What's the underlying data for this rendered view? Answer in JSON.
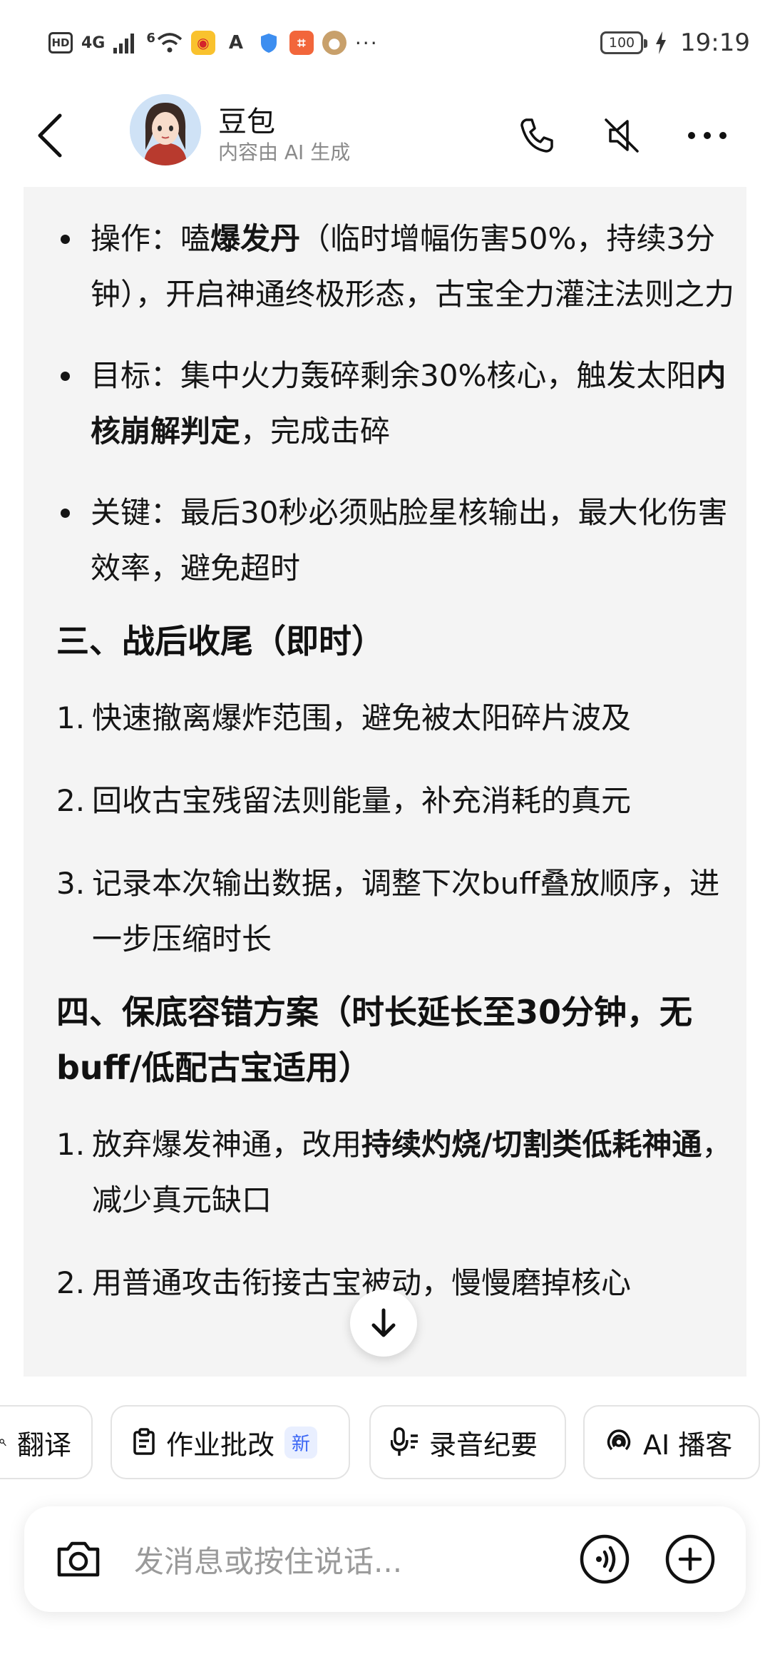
{
  "status_bar": {
    "hd": "HD",
    "network": "4G",
    "wifi_tag": "6",
    "dots": "···",
    "battery": "100",
    "time": "19:19"
  },
  "header": {
    "title": "豆包",
    "subtitle": "内容由 AI 生成"
  },
  "content": {
    "bullets_top": [
      {
        "pre": "操作：嗑",
        "bold": "爆发丹",
        "post": "（临时增幅伤害50%，持续3分钟），开启神通终极形态，古宝全力灌注法则之力"
      },
      {
        "pre": "目标：集中火力轰碎剩余30%核心，触发太阳",
        "bold": "内核崩解判定",
        "post": "，完成击碎"
      },
      {
        "pre": "关键：最后30秒必须贴脸星核输出，最大化伤害效率，避免超时",
        "bold": "",
        "post": ""
      }
    ],
    "section3_title": "三、战后收尾（即时）",
    "section3_items": [
      {
        "num": "1.",
        "text": "快速撤离爆炸范围，避免被太阳碎片波及"
      },
      {
        "num": "2.",
        "text": "回收古宝残留法则能量，补充消耗的真元"
      },
      {
        "num": "3.",
        "text": "记录本次输出数据，调整下次buff叠放顺序，进一步压缩时长"
      }
    ],
    "section4_title": "四、保底容错方案（时长延长至30分钟，无buff/低配古宝适用）",
    "section4_items": [
      {
        "num": "1.",
        "pre": "放弃爆发神通，改用",
        "bold": "持续灼烧/切割类低耗神通",
        "post": "，减少真元缺口"
      },
      {
        "num": "2.",
        "pre": "用普通攻击衔接古宝被动，慢慢磨掉核心",
        "bold": "",
        "post": ""
      }
    ]
  },
  "chips": [
    {
      "label": "翻译",
      "badge": ""
    },
    {
      "label": "作业批改",
      "badge": "新"
    },
    {
      "label": "录音纪要",
      "badge": ""
    },
    {
      "label": "AI 播客",
      "badge": ""
    }
  ],
  "input": {
    "placeholder": "发消息或按住说话..."
  },
  "colors": {
    "bubble_bg": "#f4f4f4",
    "badge_blue": "#3a66f5"
  }
}
